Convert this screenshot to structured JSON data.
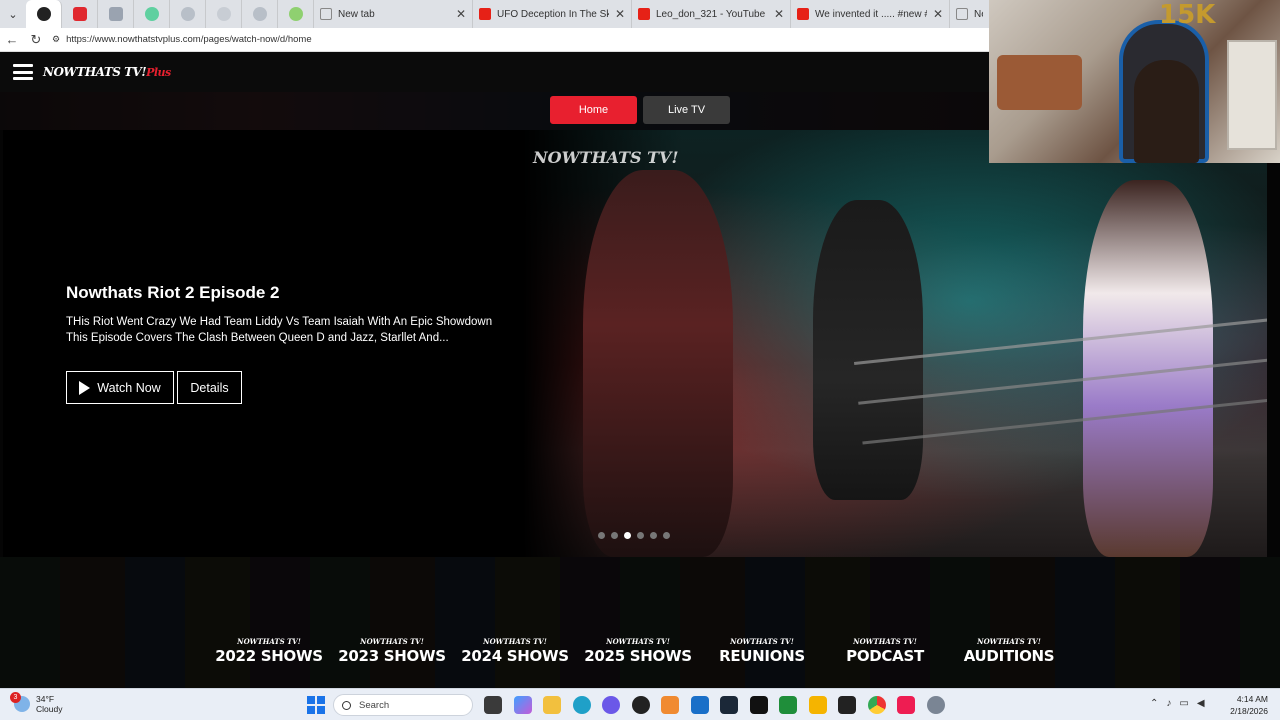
{
  "browser": {
    "tabs": [
      {
        "title": "New tab"
      },
      {
        "title": "UFO Deception In The Skies Of Ca"
      },
      {
        "title": "Leo_don_321 - YouTube"
      },
      {
        "title": "We invented it ..... #new #blackhi"
      },
      {
        "title": "Ne"
      }
    ],
    "url": "https://www.nowthatstvplus.com/pages/watch-now/d/home"
  },
  "site": {
    "logo_text": "NOWTHATS TV!",
    "logo_plus": "Plus",
    "nav": {
      "home": "Home",
      "live": "Live TV"
    },
    "hero": {
      "image_label": "NOWTHATS TV!",
      "title": "Nowthats Riot 2 Episode 2",
      "description": "THis Riot Went Crazy We Had Team Liddy Vs Team Isaiah With An Epic Showdown This Episode Covers The Clash Between Queen D and Jazz, Starllet And...",
      "watch_label": "Watch Now",
      "details_label": "Details",
      "active_slide": 3,
      "slide_count": 6
    },
    "shows": [
      {
        "mini": "NOWTHATS TV!",
        "label": "2022 SHOWS"
      },
      {
        "mini": "NOWTHATS TV!",
        "label": "2023 SHOWS"
      },
      {
        "mini": "NOWTHATS TV!",
        "label": "2024 SHOWS"
      },
      {
        "mini": "NOWTHATS TV!",
        "label": "2025 SHOWS"
      },
      {
        "mini": "NOWTHATS TV!",
        "label": "REUNIONS"
      },
      {
        "mini": "NOWTHATS TV!",
        "label": "PODCAST"
      },
      {
        "mini": "NOWTHATS TV!",
        "label": "AUDITIONS"
      }
    ],
    "accent": "#e8202f"
  },
  "webcam": {
    "badge": "15K"
  },
  "taskbar": {
    "weather_badge": "3",
    "temperature": "34°F",
    "condition": "Cloudy",
    "search_placeholder": "Search",
    "time": "4:14 AM",
    "date": "2/18/2026"
  }
}
